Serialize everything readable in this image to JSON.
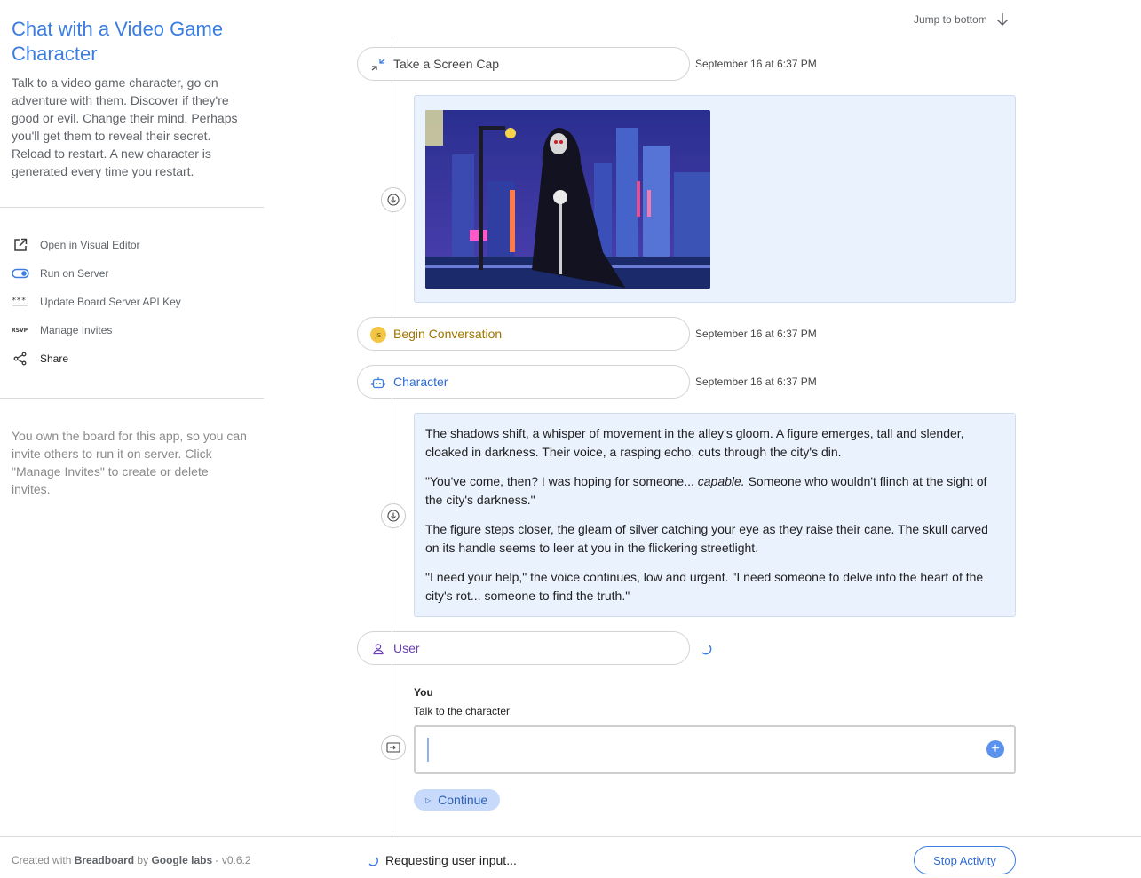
{
  "sidebar": {
    "title": "Chat with a Video Game Character",
    "description": "Talk to a video game character, go on adventure with them. Discover if they're good or evil. Change their mind. Perhaps you'll get them to reveal their secret. Reload to restart. A new character is generated every time you restart.",
    "menu": [
      {
        "label": "Open in Visual Editor",
        "icon": "open-external-icon"
      },
      {
        "label": "Run on Server",
        "icon": "toggle-icon"
      },
      {
        "label": "Update Board Server API Key",
        "icon": "asterisks-icon"
      },
      {
        "label": "Manage Invites",
        "icon": "rsvp-icon"
      },
      {
        "label": "Share",
        "icon": "share-icon"
      }
    ],
    "owner_note": "You own the board for this app, so you can invite others to run it on server. Click \"Manage Invites\" to create or delete invites.",
    "footer": {
      "prefix": "Created with",
      "brand": "Breadboard",
      "by": "by",
      "org": "Google labs",
      "version": "- v0.6.2"
    }
  },
  "main": {
    "jump_label": "Jump to bottom",
    "nodes": [
      {
        "label": "Take a Screen Cap",
        "time": "September 16 at 6:37 PM",
        "icon": "screen-cap-icon",
        "color": "#444444"
      },
      {
        "label": "Begin Conversation",
        "time": "September 16 at 6:37 PM",
        "icon": "js-icon",
        "color": "#a07400"
      },
      {
        "label": "Character",
        "time": "September 16 at 6:37 PM",
        "icon": "robot-icon",
        "color": "#2f6bd3"
      },
      {
        "label": "User",
        "time": "",
        "icon": "user-icon",
        "color": "#6a3fb5"
      }
    ],
    "story": [
      "The shadows shift, a whisper of movement in the alley's gloom. A figure emerges, tall and slender, cloaked in darkness. Their voice, a rasping echo, cuts through the city's din.",
      {
        "before": "\"You've come, then? I was hoping for someone... ",
        "em": "capable.",
        "after": " Someone who wouldn't flinch at the sight of the city's darkness.\""
      },
      "The figure steps closer, the gleam of silver catching your eye as they raise their cane. The skull carved on its handle seems to leer at you in the flickering streetlight.",
      "\"I need your help,\" the voice continues, low and urgent. \"I need someone to delve into the heart of the city's rot... someone to find the truth.\""
    ],
    "input": {
      "who": "You",
      "description": "Talk to the character",
      "value": ""
    },
    "continue_label": "Continue",
    "status_text": "Requesting user input...",
    "stop_label": "Stop Activity"
  },
  "colors": {
    "accent": "#3b7de0",
    "card_bg": "#eaf2fe",
    "js_badge": "#f3c744"
  }
}
